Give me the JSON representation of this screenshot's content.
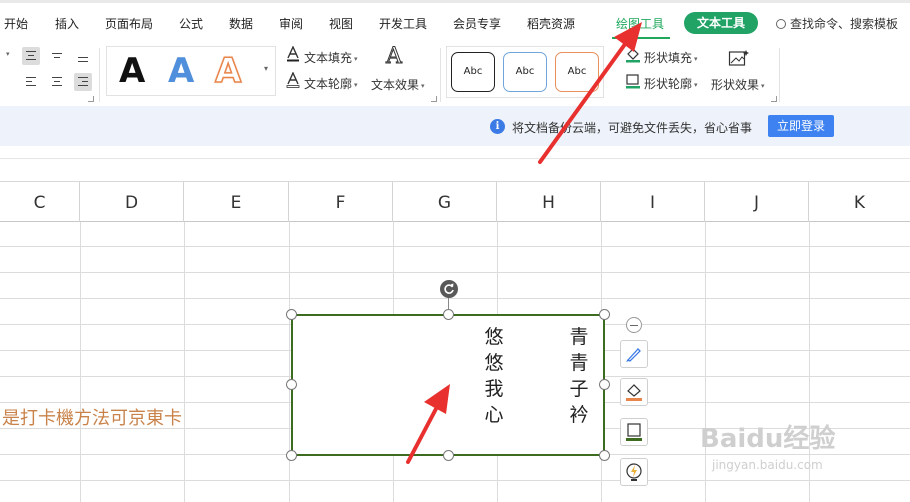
{
  "menu": {
    "items": [
      "开始",
      "插入",
      "页面布局",
      "公式",
      "数据",
      "审阅",
      "视图",
      "开发工具",
      "会员专享",
      "稻壳资源"
    ],
    "drawing_tool": "绘图工具",
    "text_tool": "文本工具",
    "search": "查找命令、搜索模板"
  },
  "ribbon": {
    "wordart_samples": [
      "A",
      "A",
      "A"
    ],
    "text_fill": "文本填充",
    "text_outline": "文本轮廓",
    "text_effect": "文本效果",
    "shape_styles": [
      "Abc",
      "Abc",
      "Abc"
    ],
    "shape_fill": "形状填充",
    "shape_outline": "形状轮廓",
    "shape_effect": "形状效果"
  },
  "notification": {
    "info_icon": "i",
    "message": "将文档备份云端，可避免文件丢失，省心省事",
    "login_button": "立即登录"
  },
  "sheet": {
    "columns": [
      "C",
      "D",
      "E",
      "F",
      "G",
      "H",
      "I",
      "J",
      "K"
    ],
    "cell_text": "是打卡機方法可京東卡"
  },
  "textbox": {
    "column_right": [
      "青",
      "青",
      "子",
      "衿"
    ],
    "column_left": [
      "悠",
      "悠",
      "我",
      "心"
    ]
  },
  "watermark": {
    "brand": "Baidu经验",
    "url": "jingyan.baidu.com"
  },
  "colors": {
    "accent_green": "#21a366",
    "arrow_red": "#e8302e",
    "shape_border": "#3d6b1f",
    "cell_text": "#c9834a",
    "login_blue": "#3d82f0"
  },
  "icons": [
    "search-icon",
    "info-icon",
    "rotate-icon",
    "minus-icon",
    "brush-icon",
    "fill-bucket-icon",
    "outline-icon",
    "lightning-icon",
    "text-fill-icon",
    "text-outline-icon",
    "text-effect-icon",
    "shape-fill-icon",
    "shape-outline-icon",
    "shape-effect-icon"
  ]
}
